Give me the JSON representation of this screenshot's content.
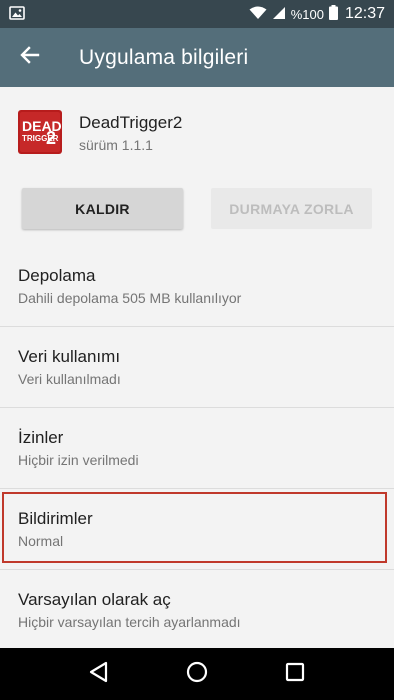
{
  "status_bar": {
    "battery_text": "%100",
    "clock": "12:37"
  },
  "app_bar": {
    "title": "Uygulama bilgileri"
  },
  "app": {
    "name": "DeadTrigger2",
    "version": "sürüm 1.1.1",
    "icon_text_top": "DEAD",
    "icon_text_bottom": "TRIGGER",
    "icon_text_num": "2"
  },
  "buttons": {
    "uninstall_label": "KALDIR",
    "force_stop_label": "DURMAYA ZORLA"
  },
  "list": [
    {
      "title": "Depolama",
      "subtitle": "Dahili depolama 505 MB kullanılıyor"
    },
    {
      "title": "Veri kullanımı",
      "subtitle": "Veri kullanılmadı"
    },
    {
      "title": "İzinler",
      "subtitle": "Hiçbir izin verilmedi"
    },
    {
      "title": "Bildirimler",
      "subtitle": "Normal"
    },
    {
      "title": "Varsayılan olarak aç",
      "subtitle": "Hiçbir varsayılan tercih ayarlanmadı"
    }
  ],
  "colors": {
    "status_bar": "#37474f",
    "app_bar": "#546e7a",
    "highlight": "#c0392b"
  }
}
